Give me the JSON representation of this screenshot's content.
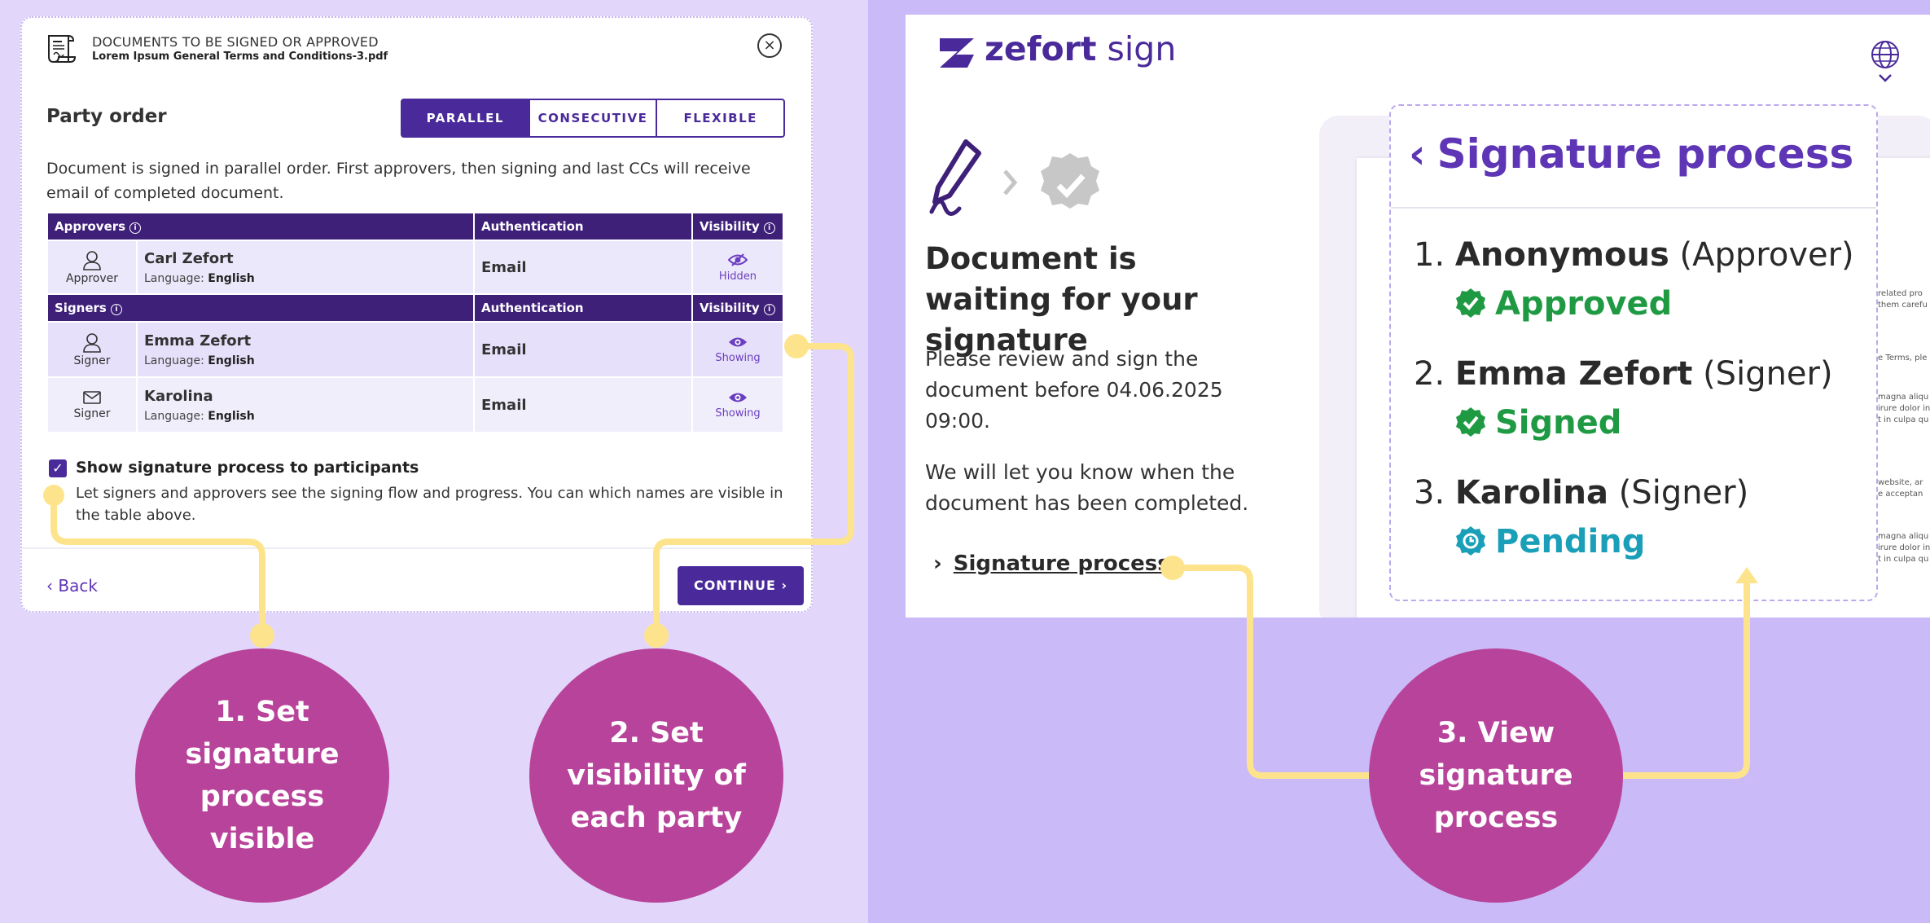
{
  "dialog": {
    "title": "DOCUMENTS TO BE SIGNED OR APPROVED",
    "filename": "Lorem Ipsum General Terms and Conditions-3.pdf",
    "close_glyph": "×",
    "party_order_label": "Party order",
    "order_options": [
      "PARALLEL",
      "CONSECUTIVE",
      "FLEXIBLE"
    ],
    "selected_order": "PARALLEL",
    "description": "Document is signed in parallel order. First approvers, then signing and last CCs will receive email of completed document.",
    "approvers_header": "Approvers",
    "signers_header": "Signers",
    "auth_header": "Authentication",
    "visibility_header": "Visibility",
    "language_prefix": "Language:",
    "approvers": [
      {
        "role": "Approver",
        "name": "Carl Zefort",
        "language": "English",
        "auth": "Email",
        "visibility": "Hidden",
        "icon": "person-icon"
      }
    ],
    "signers": [
      {
        "role": "Signer",
        "name": "Emma Zefort",
        "language": "English",
        "auth": "Email",
        "visibility": "Showing",
        "icon": "person-icon"
      },
      {
        "role": "Signer",
        "name": "Karolina",
        "language": "English",
        "auth": "Email",
        "visibility": "Showing",
        "icon": "envelope-icon"
      }
    ],
    "show_process_label": "Show signature process to participants",
    "show_process_checked": true,
    "show_process_desc": "Let signers and approvers see the signing flow and progress. You can which names are visible in the table above.",
    "back_label": "Back",
    "continue_label": "CONTINUE"
  },
  "bubbles": [
    "1. Set signature process visible",
    "2. Set visibility of each party",
    "3. View signature process"
  ],
  "app": {
    "logo_bold": "zefort",
    "logo_light": "sign",
    "wait_title": "Document is waiting for your signature",
    "wait_p1": "Please review and sign the document before 04.06.2025 09:00.",
    "wait_p2": "We will let you know when the document has been completed.",
    "sig_link": "Signature process",
    "doc_snippets": [
      "related pro",
      "them carefu",
      "e Terms, ple",
      "magna aliqu",
      "irure dolor in",
      "t in culpa qu",
      "website, ar",
      "e acceptan",
      "magna aliqu",
      "irure dolor in",
      "t in culpa qu"
    ]
  },
  "signature_process": {
    "title": "Signature process",
    "items": [
      {
        "num": "1.",
        "name": "Anonymous",
        "role": "(Approver)",
        "status": "Approved",
        "color": "#1f9a43"
      },
      {
        "num": "2.",
        "name": "Emma Zefort",
        "role": "(Signer)",
        "status": "Signed",
        "color": "#1f9a43"
      },
      {
        "num": "3.",
        "name": "Karolina",
        "role": "(Signer)",
        "status": "Pending",
        "color": "#1a9fb8"
      }
    ]
  },
  "colors": {
    "primary": "#4a2a9a",
    "bubble": "#b8439a",
    "connector": "#fde48c",
    "bg_left": "#e2d7fb",
    "bg_right": "#cbbaf8"
  }
}
